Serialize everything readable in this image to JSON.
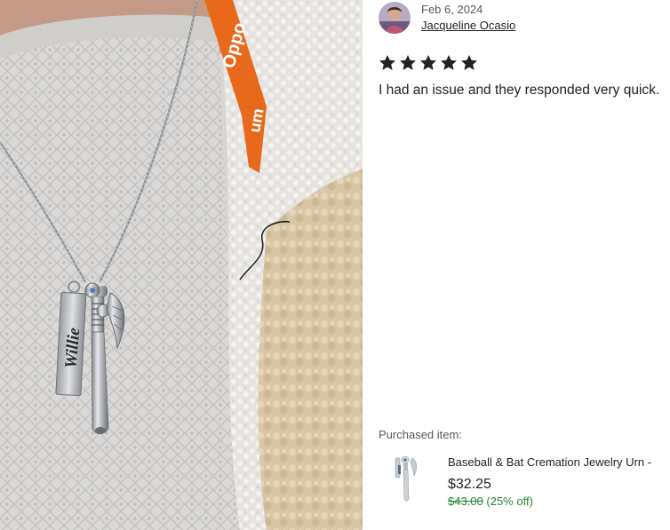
{
  "review": {
    "date": "Feb 6, 2024",
    "reviewer_name": "Jacqueline Ocasio",
    "rating": 5,
    "rating_max": 5,
    "text": "I had an issue and they responded very quick."
  },
  "photo": {
    "lanyard_text": "Oppo",
    "lanyard_text_2": "um",
    "engraving": "Willie"
  },
  "purchased": {
    "label": "Purchased item:",
    "title": "Baseball & Bat Cremation Jewelry Urn -",
    "price": "$32.25",
    "original_price": "$43.00",
    "discount": "(25% off)"
  },
  "colors": {
    "text": "#222222",
    "muted": "#595959",
    "star": "#222222",
    "discount_green": "#258635",
    "lanyard_orange": "#e8691c"
  },
  "icons": {
    "star": "star-icon",
    "avatar": "avatar"
  }
}
